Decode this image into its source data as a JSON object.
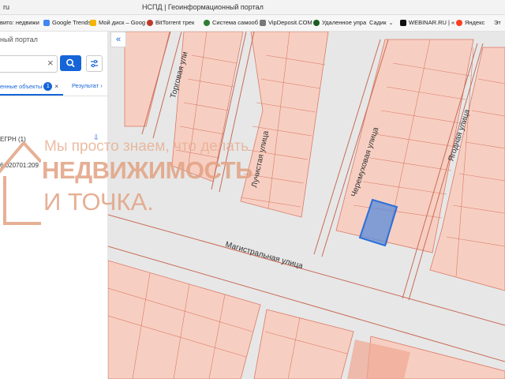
{
  "browser": {
    "left_text": "ru",
    "title": "НСПД | Геоинформационный портал"
  },
  "bookmarks": [
    {
      "label": "вито: недвижи",
      "icon": "avito-icon",
      "color": "#00aaff"
    },
    {
      "label": "Google Trends",
      "icon": "google-trends-icon",
      "color": "#4285f4"
    },
    {
      "label": "Мой диск – Goog",
      "icon": "google-drive-icon",
      "color": "#f4b400"
    },
    {
      "label": "BitTorrent трек",
      "icon": "bittorrent-icon",
      "color": "#c0392b"
    },
    {
      "label": "Система самооб",
      "icon": "system-icon",
      "color": "#2e7d32"
    },
    {
      "label": "VipDeposit.COM",
      "icon": "vipdeposit-icon",
      "color": "#777777"
    },
    {
      "label": "Удаленное упра",
      "icon": "remote-control-icon",
      "color": "#1b5e20"
    },
    {
      "label": "Садик",
      "icon": "bookmark-icon",
      "color": "#666666"
    },
    {
      "label": "WEBINAR.RU | «",
      "icon": "webinar-icon",
      "color": "#111111"
    },
    {
      "label": "Яндекс",
      "icon": "yandex-icon",
      "color": "#fc3f1d"
    },
    {
      "label": "Эт",
      "icon": "bookmark-icon",
      "color": "#888888"
    }
  ],
  "sidebar": {
    "portal_title": "ный портал",
    "search_value": "",
    "tabs": [
      {
        "label": "енные объекты",
        "count": "1"
      },
      {
        "label": "Результат"
      }
    ],
    "result_group": "ЕГРН (1)",
    "cadastral_number": "6:020701:209"
  },
  "map": {
    "streets": [
      "Торговая ули",
      "Лучистая улица",
      "Черемуховая улица",
      "Ягодная улица",
      "Магистральная улица"
    ],
    "parcel_color": "#f4b9a6",
    "selected_color": "#2c6fd6"
  },
  "watermark": {
    "line1": "Мы просто знаем, что делать",
    "line2": "НЕДВИЖИМОСТЬ",
    "line3": "И ТОЧКА."
  },
  "colors": {
    "accent": "#1565d8",
    "watermark": "#e2a283"
  }
}
